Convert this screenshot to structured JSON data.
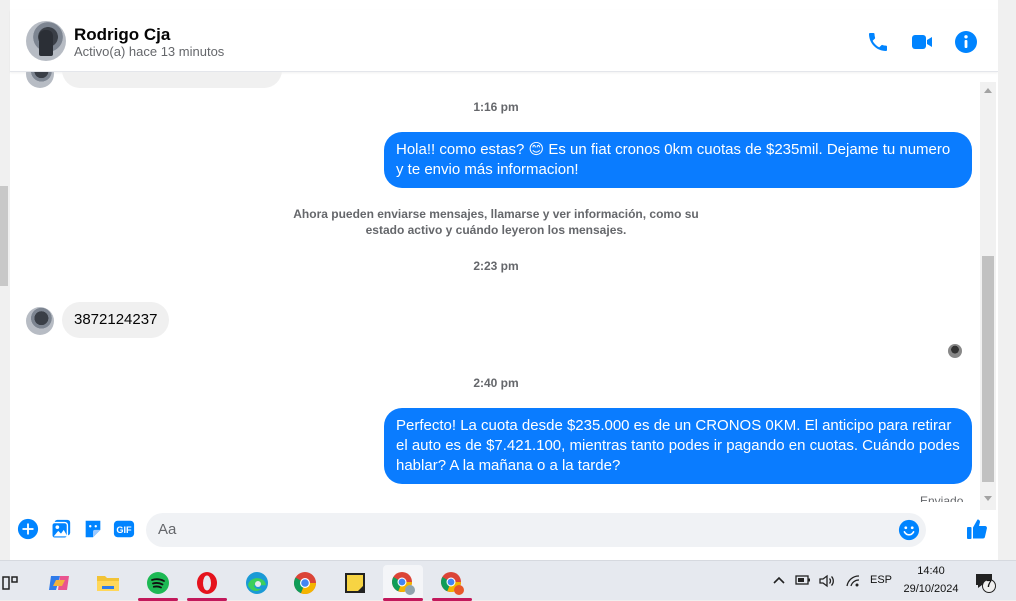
{
  "header": {
    "contact_name": "Rodrigo Cja",
    "contact_status": "Activo(a) hace 13 minutos",
    "icons": [
      "phone-icon",
      "video-icon",
      "info-icon"
    ]
  },
  "messages": {
    "time_1": "1:16 pm",
    "out_1": "Hola!! como estas? 😊 Es un fiat cronos 0km cuotas de $235mil. Dejame tu numero y te envio más informacion!",
    "system_note": "Ahora pueden enviarse mensajes, llamarse y ver información, como su estado activo y cuándo leyeron los mensajes.",
    "time_2": "2:23 pm",
    "in_1": "3872124237",
    "time_3": "2:40 pm",
    "out_2": "Perfecto! La cuota desde $235.000 es de un CRONOS 0KM. El anticipo para retirar el auto es de $7.421.100, mientras tanto podes ir pagando en cuotas. Cuándo podes hablar? A la mañana o a la tarde?",
    "sent_status": "Enviado"
  },
  "composer": {
    "placeholder": "Aa",
    "gif_label": "GIF"
  },
  "taskbar": {
    "apps": [
      "task-view",
      "copilot",
      "file-explorer",
      "spotify",
      "opera",
      "edge",
      "chrome",
      "sticky-notes",
      "chrome-profile-1",
      "chrome-profile-2"
    ],
    "language": "ESP",
    "time": "14:40",
    "date": "29/10/2024",
    "notification_count": "7"
  },
  "colors": {
    "accent": "#0a7cff",
    "header_icons": "#0084ff"
  }
}
